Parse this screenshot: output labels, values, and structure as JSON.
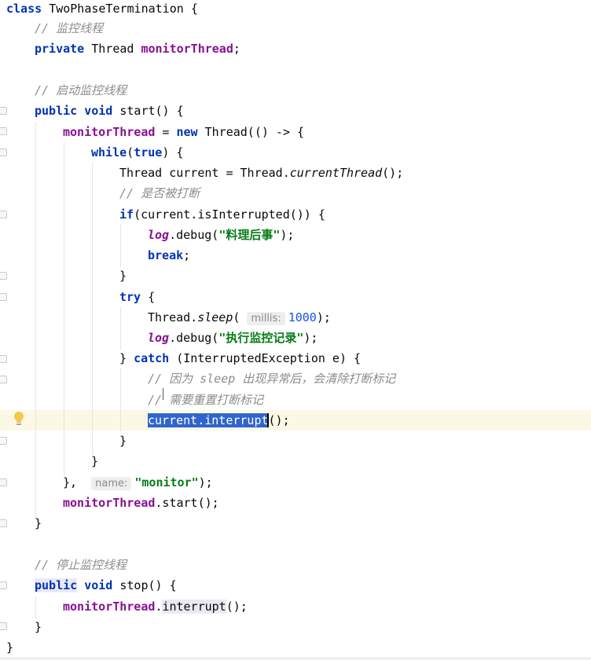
{
  "editor": {
    "lines": {
      "class_decl": {
        "kw": "class",
        "name": "TwoPhaseTermination",
        "brace": "{"
      },
      "c_monitor_thread": "// 监控线程",
      "field_decl": {
        "kw": "private",
        "type": "Thread",
        "name": "monitorThread",
        "semi": ";"
      },
      "c_start_monitor": "// 启动监控线程",
      "start_decl": {
        "kw1": "public",
        "kw2": "void",
        "rest": "start() {"
      },
      "assign": {
        "field": "monitorThread",
        "eq": " = ",
        "kw": "new",
        "rest": " Thread(() -> {"
      },
      "while_line": {
        "kw": "while",
        "open": "(",
        "kw2": "true",
        "rest": ") {"
      },
      "current_line": {
        "prefix": "Thread current = Thread.",
        "method": "currentThread",
        "suffix": "();"
      },
      "c_interrupted": "// 是否被打断",
      "if_line": {
        "kw": "if",
        "rest": "(current.isInterrupted()) {"
      },
      "log1": {
        "log": "log",
        "call": ".debug(",
        "str": "\"料理后事\"",
        "end": ");"
      },
      "break_line": {
        "kw": "break",
        "end": ";"
      },
      "close1": "}",
      "try_line": {
        "kw": "try",
        "rest": " {"
      },
      "sleep_line": {
        "prefix": "Thread.",
        "method": "sleep",
        "open": "(",
        "hint": "millis:",
        "num": "1000",
        "end": ");"
      },
      "log2": {
        "log": "log",
        "call": ".debug(",
        "str": "\"执行监控记录\"",
        "end": ");"
      },
      "catch_line": {
        "close": "} ",
        "kw": "catch",
        "rest": " (InterruptedException e) {"
      },
      "c_because": "// 因为 sleep 出现异常后，会清除打断标记",
      "c_reset": "// 需要重置打断标记",
      "interrupt_line": {
        "selected": "current.interrupt",
        "rest": "();"
      },
      "close2": "}",
      "close3": "}",
      "thread_end": {
        "prefix": "}, ",
        "hint": "name:",
        "str": "\"monitor\"",
        "end": ");"
      },
      "start_call": {
        "field": "monitorThread",
        "rest": ".start();"
      },
      "close4": "}",
      "c_stop_monitor": "// 停止监控线程",
      "stop_decl": {
        "kw1": "public",
        "kw2": "void",
        "rest": "stop() {"
      },
      "interrupt_call": {
        "field": "monitorThread",
        "dot": ".",
        "method": "interrupt",
        "end": "();"
      },
      "close5": "}",
      "close6": "}"
    }
  },
  "colors": {
    "keyword": "#0033b3",
    "field": "#871094",
    "comment": "#8c8c8c",
    "string": "#067d17",
    "number": "#1750eb",
    "selection": "#2f65ca",
    "caret_line": "#fbf8e6"
  },
  "icons": {
    "intention": "lightbulb-icon",
    "fold": "fold-marker-icon"
  }
}
